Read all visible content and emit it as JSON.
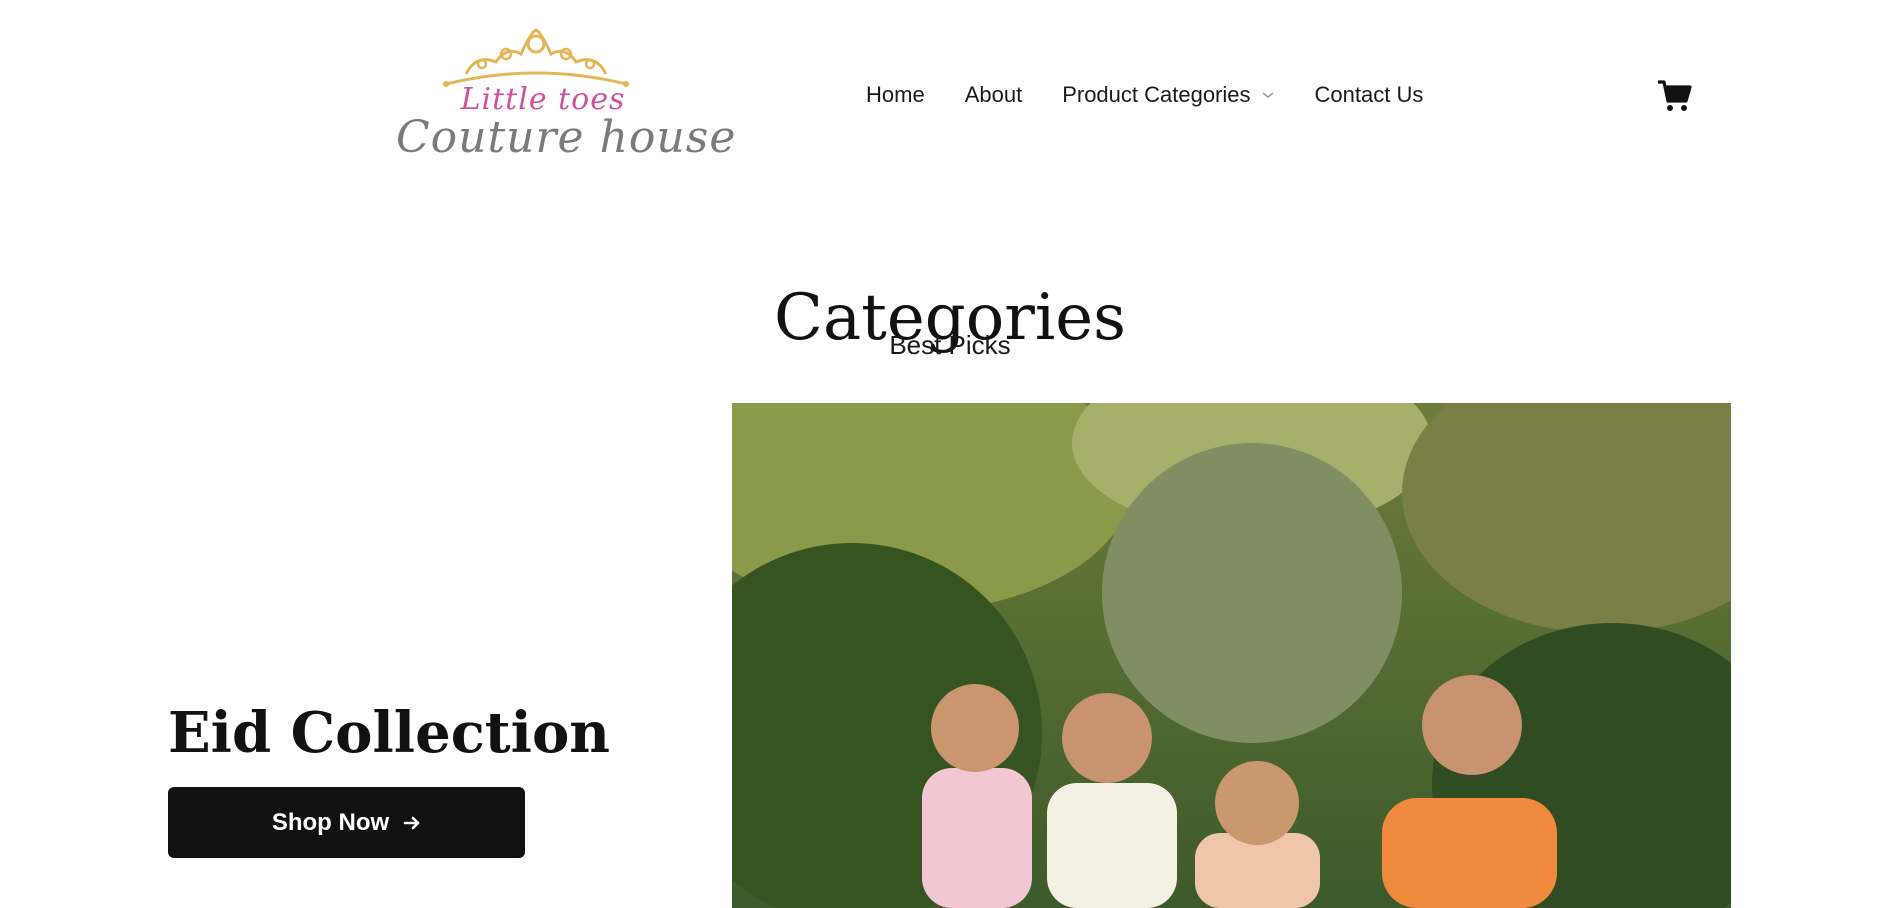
{
  "logo": {
    "line1": "Little toes",
    "line2": "Couture house",
    "crown_color": "#e3b65a",
    "line1_color": "#d0529a",
    "line2_color": "#7a7a7a"
  },
  "nav": {
    "items": [
      {
        "label": "Home"
      },
      {
        "label": "About"
      },
      {
        "label": "Product Categories",
        "has_dropdown": true
      },
      {
        "label": "Contact Us"
      }
    ],
    "cart_icon": "shopping-cart-icon"
  },
  "categories": {
    "title": "Categories",
    "subtitle": "Best Picks"
  },
  "feature": {
    "collection_title": "Eid Collection",
    "button_label": "Shop Now",
    "button_icon": "arrow-right-icon",
    "button_color": "#111111"
  }
}
